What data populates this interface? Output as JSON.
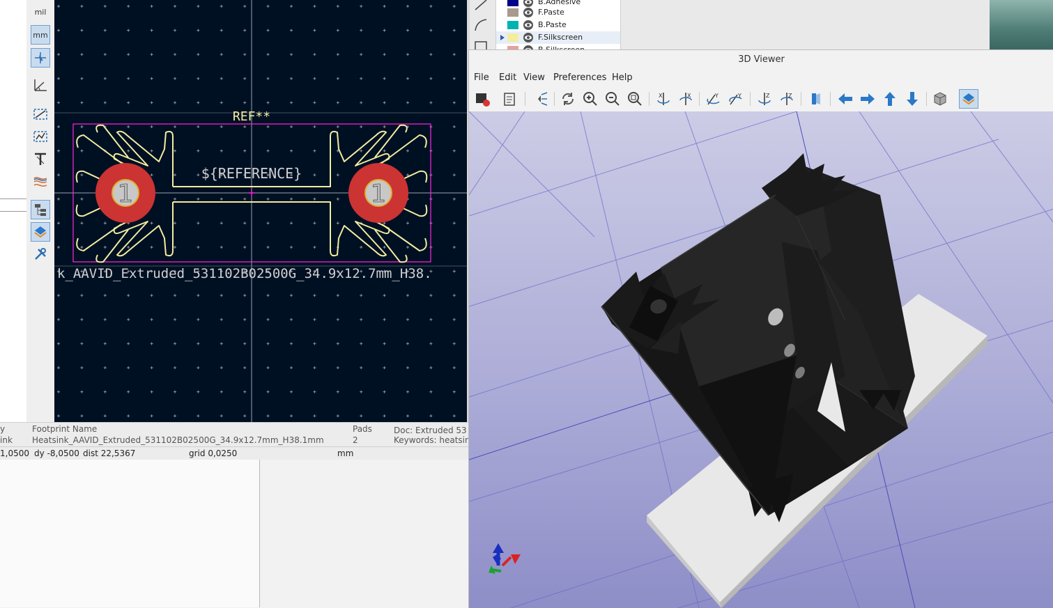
{
  "editor": {
    "units": {
      "mil": "mil",
      "mm": "mm"
    },
    "canvas": {
      "ref_text": "REF**",
      "value_text": "${REFERENCE}",
      "pad_left_label": "1",
      "pad_right_label": "1",
      "footprint_text": "k_AAVID_Extruded_531102B02500G_34.9x12.7mm_H38."
    },
    "colors": {
      "background": "#001023",
      "silkscreen": "#f2eda1",
      "pad": "#cc3333",
      "courtyard": "#ff26e2"
    }
  },
  "status": {
    "lib_cut": "y",
    "lib_value_cut": "ink",
    "footprint_name_label": "Footprint Name",
    "footprint_name_value": "Heatsink_AAVID_Extruded_531102B02500G_34.9x12.7mm_H38.1mm",
    "pads_label": "Pads",
    "pads_value": "2",
    "doc_text": "Doc: Extruded 53",
    "keywords_text": "Keywords: heatsin",
    "dx": "1,0500",
    "dy": "dy -8,0500",
    "dist": "dist 22,5367",
    "grid": "grid 0,0250",
    "units": "mm"
  },
  "layers": [
    {
      "name": "B.Adhesive",
      "color": "#00008b"
    },
    {
      "name": "F.Paste",
      "color": "#a89a8e"
    },
    {
      "name": "B.Paste",
      "color": "#00b3b3"
    },
    {
      "name": "F.Silkscreen",
      "color": "#f2eda1"
    },
    {
      "name": "B.Silkscreen",
      "color": "#e6a0a0"
    }
  ],
  "viewer": {
    "title": "3D Viewer",
    "menu": [
      "File",
      "Edit",
      "View",
      "Preferences",
      "Help"
    ]
  }
}
